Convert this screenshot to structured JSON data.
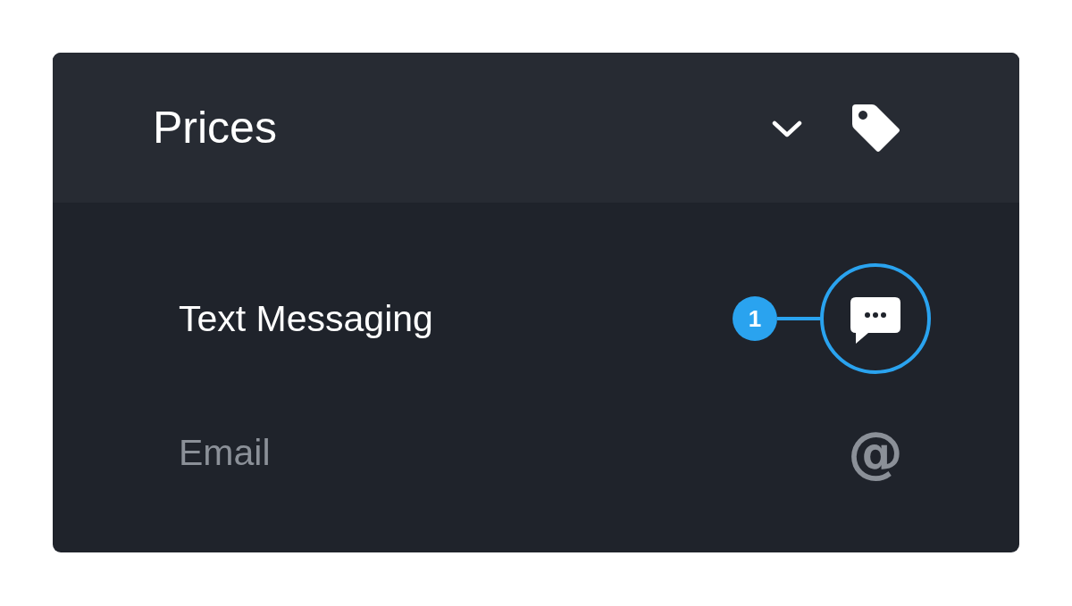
{
  "header": {
    "title": "Prices"
  },
  "rows": [
    {
      "label": "Text Messaging",
      "active": true,
      "kind": "message",
      "callout": "1"
    },
    {
      "label": "Email",
      "active": false,
      "kind": "glyph",
      "glyph": "@"
    }
  ]
}
